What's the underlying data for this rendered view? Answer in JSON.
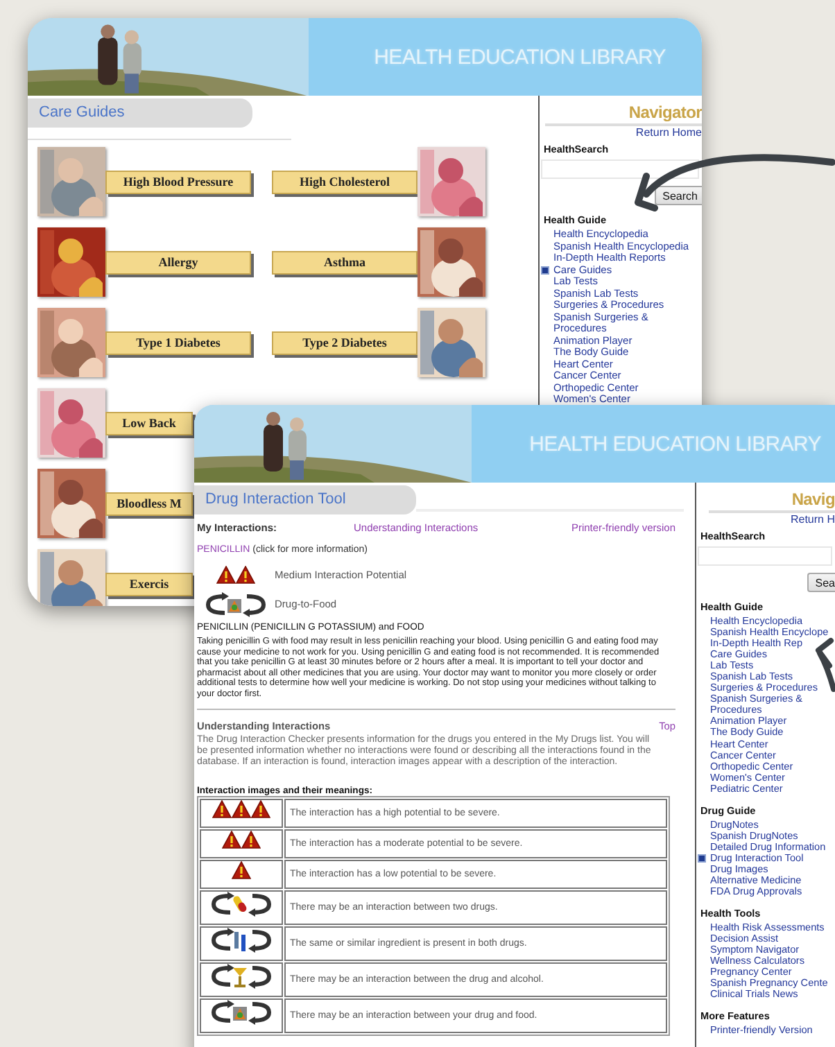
{
  "care_page": {
    "banner_title": "HEALTH EDUCATION LIBRARY",
    "tab": "Care Guides",
    "topics": [
      {
        "labels": [
          "High Blood Pressure",
          "High Cholesterol"
        ]
      },
      {
        "labels": [
          "Allergy",
          "Asthma"
        ]
      },
      {
        "labels": [
          "Type 1 Diabetes",
          "Type 2 Diabetes"
        ]
      },
      {
        "labels": [
          "Low Back"
        ]
      },
      {
        "labels": [
          "Bloodless M"
        ]
      },
      {
        "labels": [
          "Exercis"
        ]
      }
    ],
    "navigator": {
      "title": "Navigator",
      "return_link": "Return Home",
      "search_label": "HealthSearch",
      "search_button": "Search",
      "sections": [
        {
          "heading": "Health Guide",
          "items": [
            {
              "label": "Health Encyclopedia",
              "selected": false
            },
            {
              "label": "Spanish Health Encyclopedia",
              "selected": false
            },
            {
              "label": "In-Depth Health Reports",
              "selected": false
            },
            {
              "label": "Care Guides",
              "selected": true
            },
            {
              "label": "Lab Tests",
              "selected": false
            },
            {
              "label": "Spanish Lab Tests",
              "selected": false
            },
            {
              "label": "Surgeries & Procedures",
              "selected": false
            },
            {
              "label": "Spanish Surgeries & Procedures",
              "selected": false
            },
            {
              "label": "Animation Player",
              "selected": false
            },
            {
              "label": "The Body Guide",
              "selected": false
            },
            {
              "label": "Heart Center",
              "selected": false
            },
            {
              "label": "Cancer Center",
              "selected": false
            },
            {
              "label": "Orthopedic Center",
              "selected": false
            },
            {
              "label": "Women's Center",
              "selected": false
            }
          ]
        }
      ]
    }
  },
  "drug_page": {
    "banner_title": "HEALTH EDUCATION LIBRARY",
    "tab": "Drug Interaction Tool",
    "header": {
      "label": "My Interactions:",
      "links": [
        "Understanding Interactions",
        "Printer-friendly version"
      ]
    },
    "drug": {
      "name": "PENICILLIN",
      "note": "(click for more information)"
    },
    "interactions": [
      {
        "kind": "moderate",
        "label": "Medium Interaction Potential"
      },
      {
        "kind": "food",
        "label": "Drug-to-Food"
      }
    ],
    "detail": {
      "title": "PENICILLIN (PENICILLIN G POTASSIUM) and FOOD",
      "text": "Taking penicillin G with food may result in less penicillin reaching your blood. Using penicillin G and eating food may cause your medicine to not work for you. Using penicillin G and eating food is not recommended. It is recommended that you take penicillin G at least 30 minutes before or 2 hours after a meal. It is important to tell your doctor and pharmacist about all other medicines that you are using. Your doctor may want to monitor you more closely or order additional tests to determine how well your medicine is working. Do not stop using your medicines without talking to your doctor first."
    },
    "understanding": {
      "title": "Understanding Interactions",
      "top_link": "Top",
      "text": "The Drug Interaction Checker presents information for the drugs you entered in the My Drugs list. You will be presented information whether no interactions were found or describing all the interactions found in the database. If an interaction is found, interaction images appear with a description of the interaction."
    },
    "legend": {
      "title": "Interaction images and their meanings:",
      "rows": [
        {
          "kind": "high",
          "text": "The interaction has a high potential to be severe."
        },
        {
          "kind": "moderate",
          "text": "The interaction has a moderate potential to be severe."
        },
        {
          "kind": "low",
          "text": "The interaction has a low potential to be severe."
        },
        {
          "kind": "drug",
          "text": "There may be an interaction between two drugs."
        },
        {
          "kind": "ingredient",
          "text": "The same or similar ingredient is present in both drugs."
        },
        {
          "kind": "alcohol",
          "text": "There may be an interaction between the drug and alcohol."
        },
        {
          "kind": "food",
          "text": "There may be an interaction between your drug and food."
        }
      ]
    },
    "navigator": {
      "title": "Navig",
      "return_link": "Return H",
      "search_label": "HealthSearch",
      "search_button": "Sea",
      "sections": [
        {
          "heading": "Health Guide",
          "items": [
            {
              "label": "Health Encyclopedia",
              "selected": false
            },
            {
              "label": "Spanish Health Encyclope",
              "selected": false
            },
            {
              "label": "In-Depth Health Rep",
              "selected": false
            },
            {
              "label": "Care Guides",
              "selected": false
            },
            {
              "label": "Lab Tests",
              "selected": false
            },
            {
              "label": "Spanish Lab Tests",
              "selected": false
            },
            {
              "label": "Surgeries & Procedures",
              "selected": false
            },
            {
              "label": "Spanish Surgeries & Procedures",
              "selected": false
            },
            {
              "label": "Animation Player",
              "selected": false
            },
            {
              "label": "The Body Guide",
              "selected": false
            },
            {
              "label": "Heart Center",
              "selected": false
            },
            {
              "label": "Cancer Center",
              "selected": false
            },
            {
              "label": "Orthopedic Center",
              "selected": false
            },
            {
              "label": "Women's Center",
              "selected": false
            },
            {
              "label": "Pediatric Center",
              "selected": false
            }
          ]
        },
        {
          "heading": "Drug Guide",
          "items": [
            {
              "label": "DrugNotes",
              "selected": false
            },
            {
              "label": "Spanish DrugNotes",
              "selected": false
            },
            {
              "label": "Detailed Drug Information",
              "selected": false
            },
            {
              "label": "Drug Interaction Tool",
              "selected": true
            },
            {
              "label": "Drug Images",
              "selected": false
            },
            {
              "label": "Alternative Medicine",
              "selected": false
            },
            {
              "label": "FDA Drug Approvals",
              "selected": false
            }
          ]
        },
        {
          "heading": "Health Tools",
          "items": [
            {
              "label": "Health Risk Assessments",
              "selected": false
            },
            {
              "label": "Decision Assist",
              "selected": false
            },
            {
              "label": "Symptom Navigator",
              "selected": false
            },
            {
              "label": "Wellness Calculators",
              "selected": false
            },
            {
              "label": "Pregnancy Center",
              "selected": false
            },
            {
              "label": "Spanish Pregnancy Cente",
              "selected": false
            },
            {
              "label": "Clinical Trials News",
              "selected": false
            }
          ]
        },
        {
          "heading": "More Features",
          "items": [
            {
              "label": "Printer-friendly Version",
              "selected": false
            }
          ]
        }
      ]
    }
  }
}
